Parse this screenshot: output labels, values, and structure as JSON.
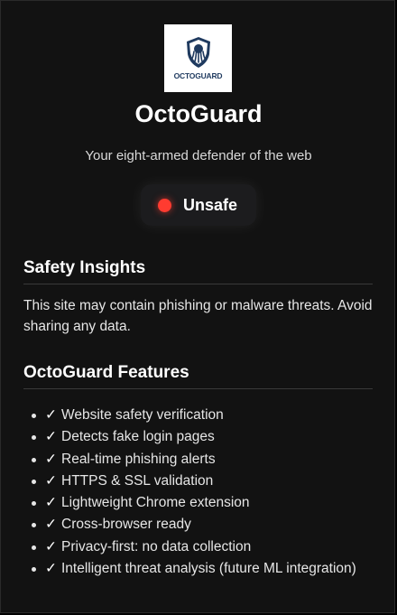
{
  "app": {
    "logo_text": "OCTOGUARD",
    "title": "OctoGuard",
    "subtitle": "Your eight-armed defender of the web"
  },
  "status": {
    "label": "Unsafe",
    "color": "#ff3b30"
  },
  "insights": {
    "heading": "Safety Insights",
    "text": "This site may contain phishing or malware threats. Avoid sharing any data."
  },
  "features": {
    "heading": "OctoGuard Features",
    "check_glyph": "✓",
    "items": [
      "Website safety verification",
      "Detects fake login pages",
      "Real-time phishing alerts",
      "HTTPS & SSL validation",
      "Lightweight Chrome extension",
      "Cross-browser ready",
      "Privacy-first: no data collection",
      "Intelligent threat analysis (future ML integration)"
    ]
  },
  "colors": {
    "background": "#121212",
    "accent_logo": "#1f3a5f",
    "danger": "#ff3b30"
  }
}
